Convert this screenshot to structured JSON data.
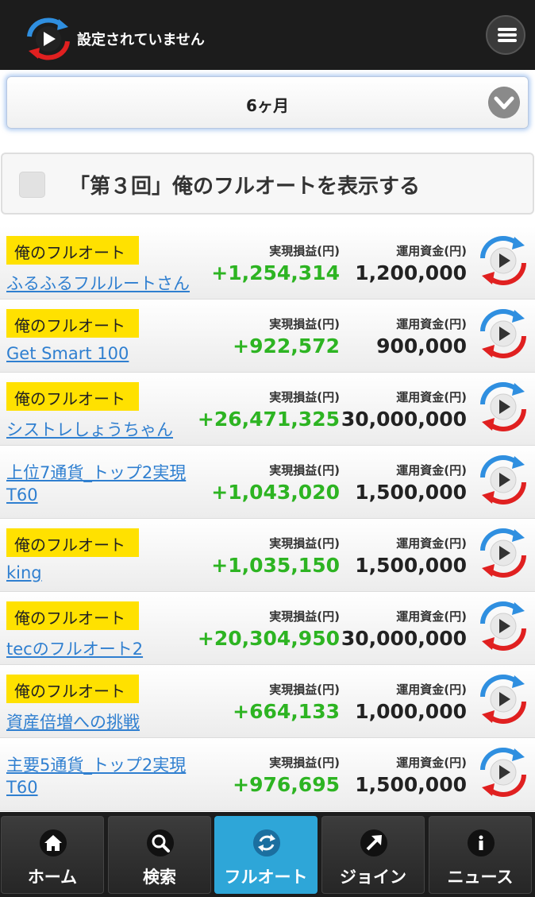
{
  "header": {
    "title": "設定されていません",
    "logo_icon": "autotrade-play-logo-icon",
    "menu_icon": "hamburger-menu-icon"
  },
  "period_select": {
    "value": "6ヶ月",
    "icon": "chevron-down-circle-icon"
  },
  "filter": {
    "label": "「第３回」俺のフルオートを表示する",
    "checked": false
  },
  "list": {
    "profit_label": "実現損益(円)",
    "capital_label": "運用資金(円)",
    "rows": [
      {
        "badge": "俺のフルオート",
        "name": "ふるふるフルルートさん",
        "profit": "+1,254,314",
        "capital": "1,200,000"
      },
      {
        "badge": "俺のフルオート",
        "name": "Get Smart 100",
        "profit": "+922,572",
        "capital": "900,000"
      },
      {
        "badge": "俺のフルオート",
        "name": "シストレしょうちゃん",
        "profit": "+26,471,325",
        "capital": "30,000,000"
      },
      {
        "badge": "",
        "name": "上位7通貨_トップ2実現T60",
        "profit": "+1,043,020",
        "capital": "1,500,000"
      },
      {
        "badge": "俺のフルオート",
        "name": "king",
        "profit": "+1,035,150",
        "capital": "1,500,000"
      },
      {
        "badge": "俺のフルオート",
        "name": "tecのフルオート2",
        "profit": "+20,304,950",
        "capital": "30,000,000"
      },
      {
        "badge": "俺のフルオート",
        "name": "資産倍増への挑戦",
        "profit": "+664,133",
        "capital": "1,000,000"
      },
      {
        "badge": "",
        "name": "主要5通貨_トップ2実現T60",
        "profit": "+976,695",
        "capital": "1,500,000"
      }
    ]
  },
  "colors": {
    "profit": "#2db422",
    "link": "#2f7fd0",
    "badge": "#ffe100",
    "nav_active": "#2ea6d8",
    "header_bg": "#1c1c1c"
  },
  "nav": {
    "items": [
      {
        "label": "ホーム",
        "icon": "home-icon",
        "active": false
      },
      {
        "label": "検索",
        "icon": "search-icon",
        "active": false
      },
      {
        "label": "フルオート",
        "icon": "refresh-icon",
        "active": true
      },
      {
        "label": "ジョイン",
        "icon": "arrow-up-right-icon",
        "active": false
      },
      {
        "label": "ニュース",
        "icon": "info-icon",
        "active": false
      }
    ]
  }
}
